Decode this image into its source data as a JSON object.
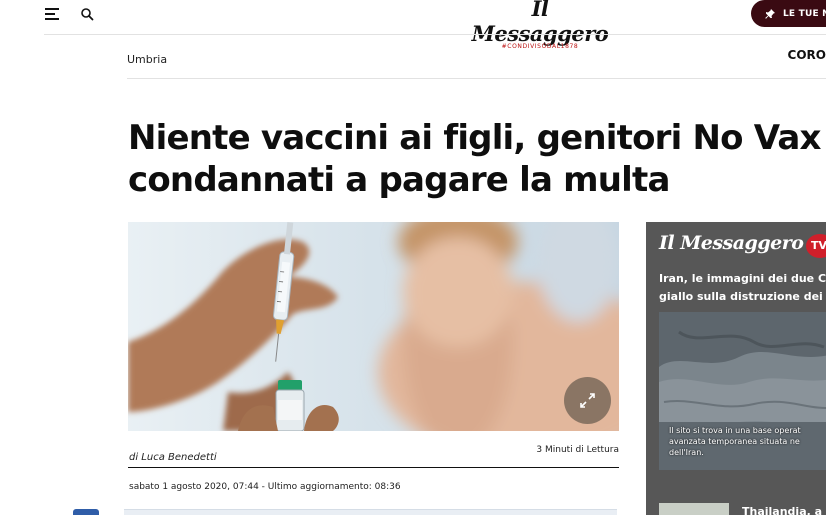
{
  "header": {
    "menu_icon": "hamburger-menu-icon",
    "search_icon": "search-icon",
    "logo_text": "Il Messaggero",
    "logo_tagline": "#CONDIVISODAL1878",
    "news_button_label": "LE TUE NO",
    "news_button_icon": "pin-icon",
    "accent_color": "#3a0a12"
  },
  "breadcrumb": {
    "section": "Umbria",
    "right_label": "CORO"
  },
  "article": {
    "title_line1": "Niente vaccini ai figli, genitori No Vax",
    "title_line2": "condannati a pagare la multa",
    "image_expand_icon": "expand-icon",
    "author": "di Luca Benedetti",
    "read_time": "3 Minuti di Lettura",
    "dateline": "sabato 1 agosto 2020, 07:44 - Ultimo aggiornamento: 08:36"
  },
  "tv": {
    "logo_text": "Il Messaggero",
    "badge": "TV",
    "badge_color": "#d01f2a",
    "title_line1": "Iran, le immagini dei due C",
    "title_line2": "giallo sulla distruzione dei",
    "caption_line1": "Il sito si trova in una base operat",
    "caption_line2": "avanzata temporanea situata ne",
    "caption_line3": "dell'Iran.",
    "next_title": "Thailandia, a"
  }
}
